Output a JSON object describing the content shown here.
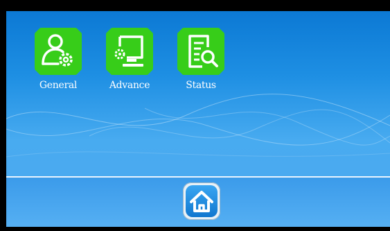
{
  "desktop": {
    "icons": [
      {
        "label": "General",
        "icon": "user-gear-icon"
      },
      {
        "label": "Advance",
        "icon": "monitor-gear-icon"
      },
      {
        "label": "Status",
        "icon": "document-search-icon"
      }
    ]
  },
  "bottom_bar": {
    "home_icon": "home-icon"
  },
  "colors": {
    "icon_tile": "#37cd19",
    "background": "#1e8fe3",
    "home_button": "#1e88dd"
  }
}
